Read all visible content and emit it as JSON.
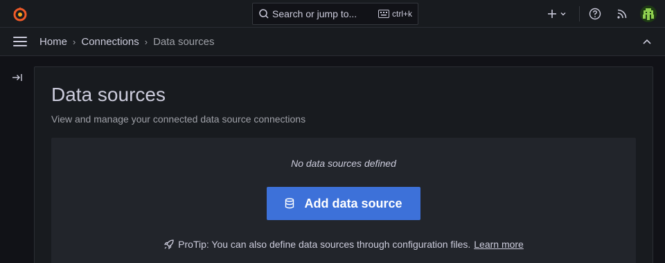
{
  "colors": {
    "background": "#111217",
    "topbar": "#181b1f",
    "panel": "#181b1f",
    "empty_box": "#22252b",
    "primary_button": "#3d71d9",
    "logo_orange": "#f05a28",
    "text_primary": "#ccccdc",
    "text_secondary": "#9fa1a8"
  },
  "topbar": {
    "logo_icon": "grafana-logo-icon",
    "search": {
      "placeholder": "Search or jump to...",
      "shortcut": "ctrl+k"
    },
    "icons": [
      "plus-icon",
      "chevron-down-icon",
      "help-icon",
      "rss-icon",
      "avatar"
    ]
  },
  "breadcrumb": {
    "items": [
      {
        "label": "Home"
      },
      {
        "label": "Connections"
      },
      {
        "label": "Data sources"
      }
    ]
  },
  "main": {
    "title": "Data sources",
    "description": "View and manage your connected data source connections",
    "empty_state": {
      "message": "No data sources defined",
      "button_label": "Add data source",
      "protip": "ProTip: You can also define data sources through configuration files.",
      "learn_more": "Learn more"
    }
  }
}
